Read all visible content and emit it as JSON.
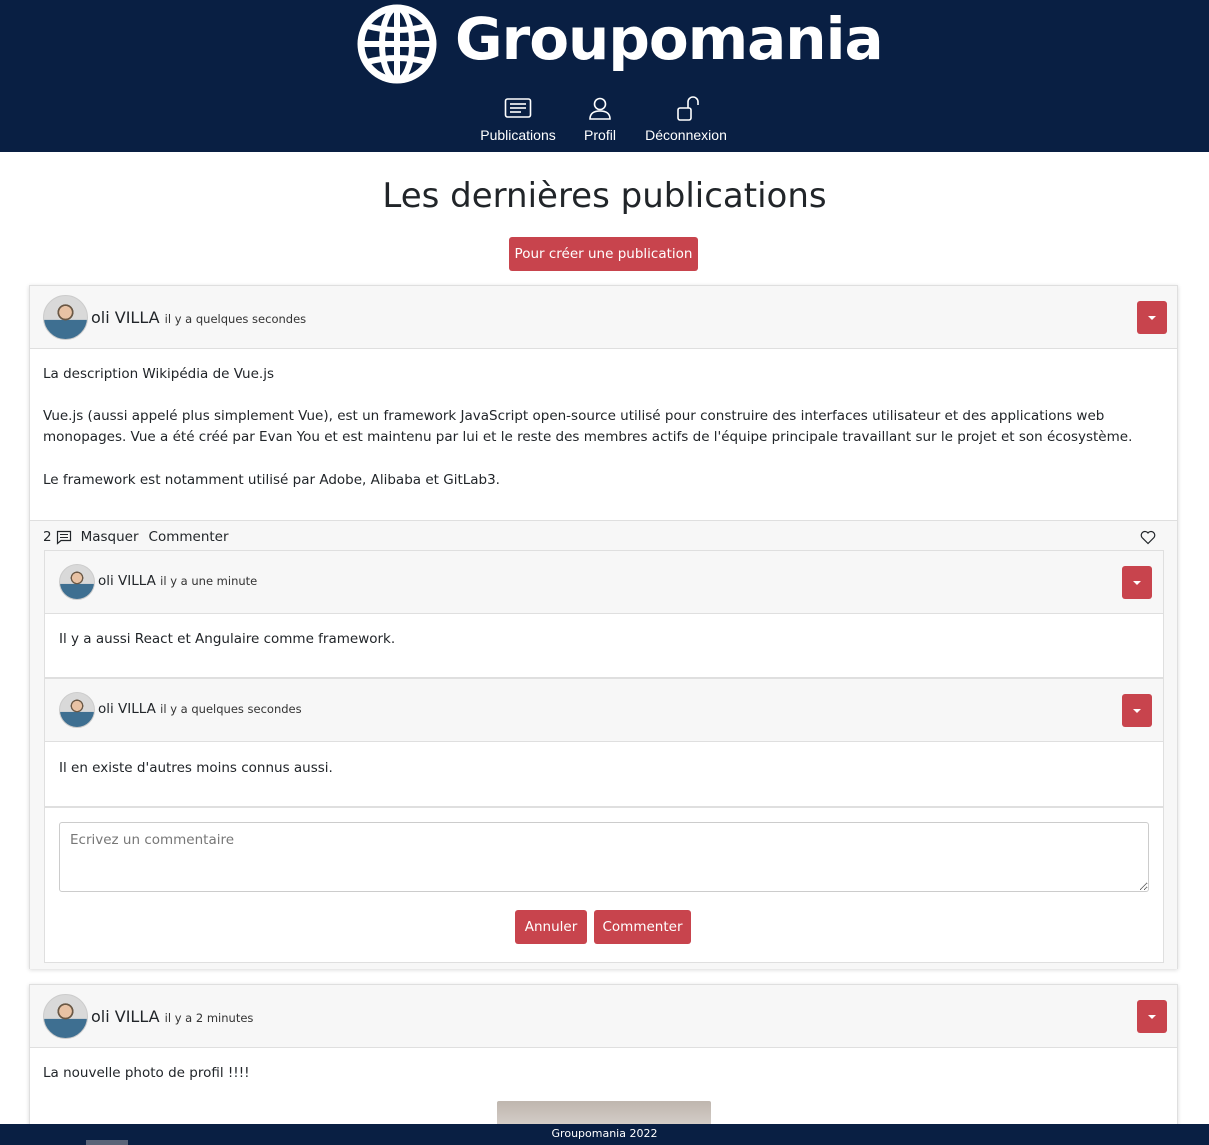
{
  "brand": {
    "name": "Groupomania"
  },
  "nav": {
    "publications": "Publications",
    "profil": "Profil",
    "deconnexion": "Déconnexion"
  },
  "main": {
    "title": "Les dernières publications",
    "create_button": "Pour créer une publication"
  },
  "posts": [
    {
      "author": "oli VILLA",
      "time": "il y a quelques secondes",
      "paragraphs": [
        "La description Wikipédia de Vue.js",
        "Vue.js (aussi appelé plus simplement Vue), est un framework JavaScript open-source utilisé pour construire des interfaces utilisateur et des applications web monopages. Vue a été créé par Evan You et est maintenu par lui et le reste des membres actifs de l'équipe principale travaillant sur le projet et son écosystème.",
        "Le framework est notamment utilisé par Adobe, Alibaba et GitLab3."
      ],
      "comment_count": "2",
      "hide_label": "Masquer",
      "comment_label": "Commenter",
      "comments": [
        {
          "author": "oli VILLA",
          "time": "il y a une minute",
          "text": "Il y a aussi React et Angulaire comme framework."
        },
        {
          "author": "oli VILLA",
          "time": "il y a quelques secondes",
          "text": "Il en existe d'autres moins connus aussi."
        }
      ],
      "form": {
        "placeholder": "Ecrivez un commentaire",
        "cancel": "Annuler",
        "submit": "Commenter"
      }
    },
    {
      "author": "oli VILLA",
      "time": "il y a 2 minutes",
      "text": "La nouvelle photo de profil !!!!"
    }
  ],
  "footer": {
    "text": "Groupomania 2022"
  },
  "colors": {
    "navy": "#091f43",
    "accent": "#c8444d"
  }
}
